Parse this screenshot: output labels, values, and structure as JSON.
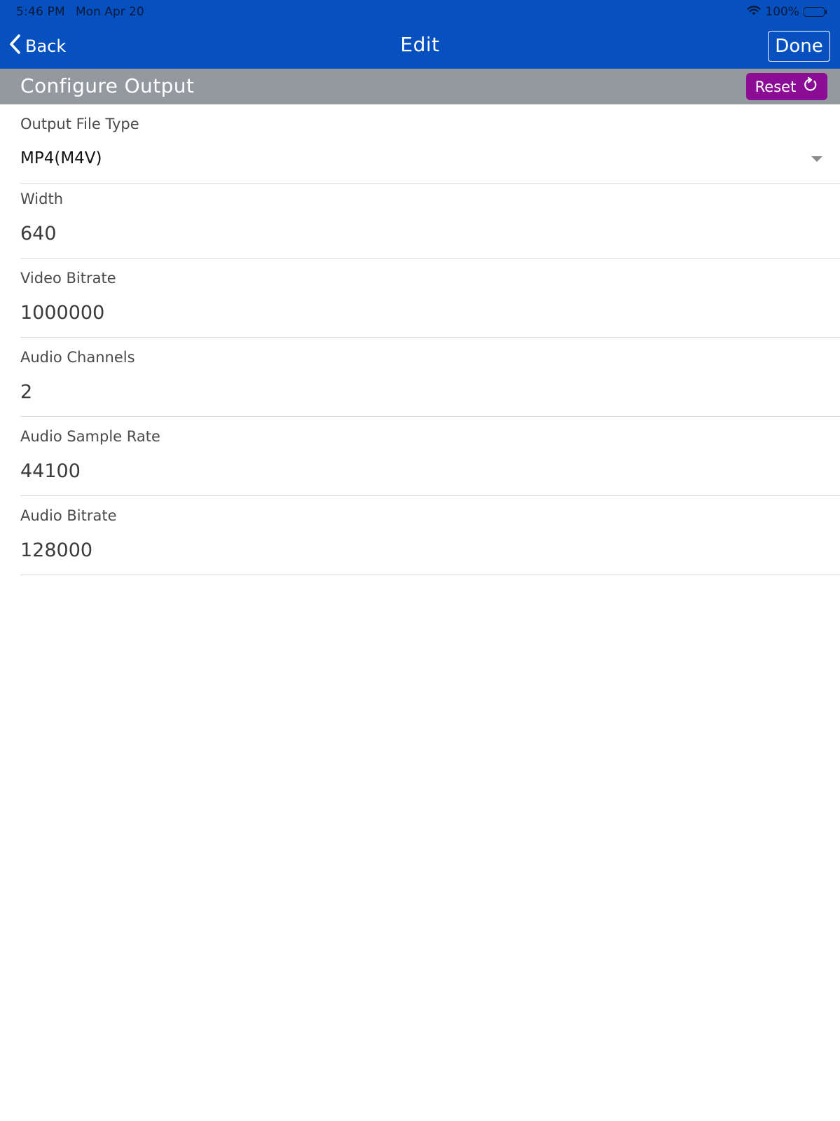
{
  "status_bar": {
    "time": "5:46 PM",
    "date": "Mon Apr 20",
    "battery": "100%"
  },
  "nav": {
    "back_label": "Back",
    "title": "Edit",
    "done_label": "Done"
  },
  "section": {
    "title": "Configure Output",
    "reset_label": "Reset"
  },
  "fields": {
    "output_file_type": {
      "label": "Output File Type",
      "value": "MP4(M4V)"
    },
    "width": {
      "label": "Width",
      "value": "640"
    },
    "video_bitrate": {
      "label": "Video Bitrate",
      "value": "1000000"
    },
    "audio_channels": {
      "label": "Audio Channels",
      "value": "2"
    },
    "audio_sample_rate": {
      "label": "Audio Sample Rate",
      "value": "44100"
    },
    "audio_bitrate": {
      "label": "Audio Bitrate",
      "value": "128000"
    }
  },
  "colors": {
    "nav_bar": "#0750bf",
    "section_header": "#9499a0",
    "reset_button": "#8b0c95"
  },
  "icons": {
    "back": "chevron-left-icon",
    "reset": "refresh-icon",
    "dropdown": "caret-down-icon",
    "wifi": "wifi-icon",
    "battery": "battery-icon"
  }
}
